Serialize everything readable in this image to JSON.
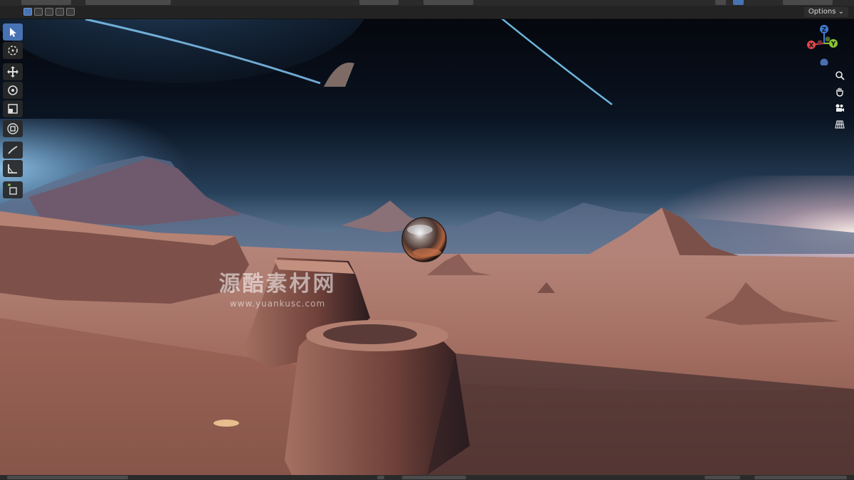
{
  "viewport_header": {
    "options_label": "Options",
    "options_icon": "chevron-down-icon"
  },
  "tools": [
    {
      "name": "select-box-tool",
      "icon": "cursor-arrow-icon",
      "active": true
    },
    {
      "name": "cursor-tool",
      "icon": "crosshair-cursor-icon",
      "active": false
    },
    {
      "name": "move-tool",
      "icon": "move-arrows-icon",
      "active": false
    },
    {
      "name": "rotate-tool",
      "icon": "rotate-icon",
      "active": false
    },
    {
      "name": "scale-tool",
      "icon": "scale-icon",
      "active": false
    },
    {
      "name": "transform-tool",
      "icon": "transform-icon",
      "active": false
    },
    {
      "name": "annotate-tool",
      "icon": "pencil-icon",
      "active": false
    },
    {
      "name": "measure-tool",
      "icon": "ruler-icon",
      "active": false
    },
    {
      "name": "add-cube-tool",
      "icon": "add-cube-icon",
      "active": false
    }
  ],
  "gizmo": {
    "x_label": "X",
    "y_label": "Y",
    "z_label": "Z",
    "colors": {
      "x": "#e2484b",
      "y": "#89c634",
      "z": "#3f7bd6",
      "neg": "#4a6fb0"
    }
  },
  "nav_buttons": [
    {
      "name": "zoom-button",
      "icon": "magnifier-icon"
    },
    {
      "name": "pan-button",
      "icon": "hand-icon"
    },
    {
      "name": "camera-view-button",
      "icon": "camera-icon"
    },
    {
      "name": "perspective-toggle-button",
      "icon": "grid-icon"
    }
  ],
  "watermark": {
    "main": "源酷素材网",
    "url": "www.yuankusc.com"
  },
  "colors": {
    "ui_dark": "#232323",
    "accent": "#4772b3",
    "sky_top": "#05070d",
    "horizon_glow": "#f0c9c8",
    "sand": "#a86e5e"
  }
}
